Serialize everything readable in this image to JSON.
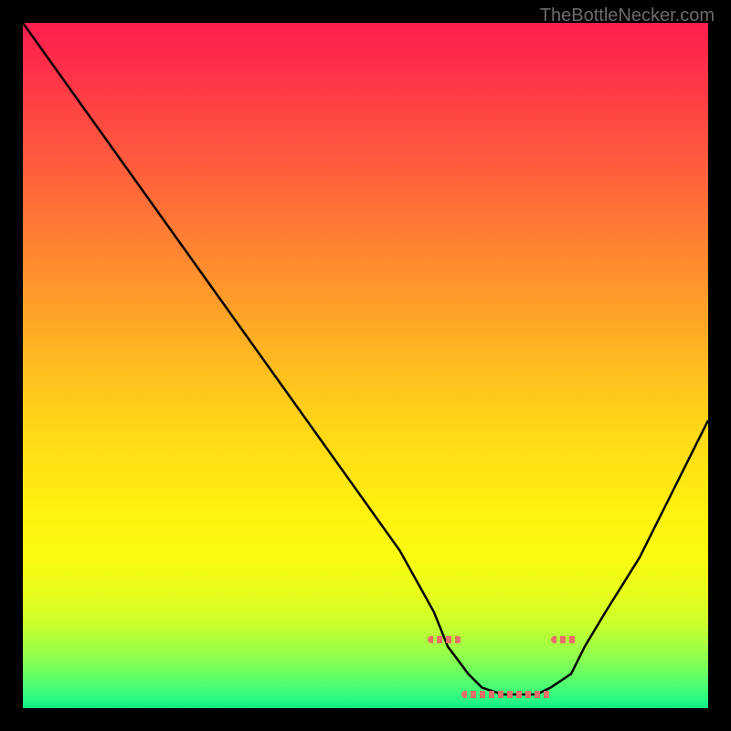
{
  "watermark": "TheBottleNecker.com",
  "chart_data": {
    "type": "line",
    "title": "",
    "xlabel": "",
    "ylabel": "",
    "x_range": [
      0,
      100
    ],
    "y_range": [
      0,
      100
    ],
    "series": [
      {
        "name": "curve",
        "x": [
          0,
          5,
          10,
          15,
          20,
          25,
          30,
          35,
          40,
          45,
          50,
          55,
          60,
          62,
          65,
          67,
          70,
          72,
          75,
          77,
          80,
          82,
          85,
          90,
          95,
          100
        ],
        "y": [
          100,
          93,
          86,
          79,
          72,
          65,
          58,
          51,
          44,
          37,
          30,
          23,
          14,
          9,
          5,
          3,
          2,
          2,
          2,
          3,
          5,
          9,
          14,
          22,
          32,
          42
        ]
      }
    ],
    "markers": {
      "left": {
        "x_start": 59,
        "x_end": 64,
        "y": 10
      },
      "band": {
        "x_start": 64,
        "x_end": 77,
        "y": 2
      },
      "right": {
        "x_start": 77,
        "x_end": 81,
        "y": 10
      }
    },
    "gradient": {
      "top": "#ff1e4e",
      "mid": "#ffd816",
      "bottom": "#10e884"
    }
  }
}
